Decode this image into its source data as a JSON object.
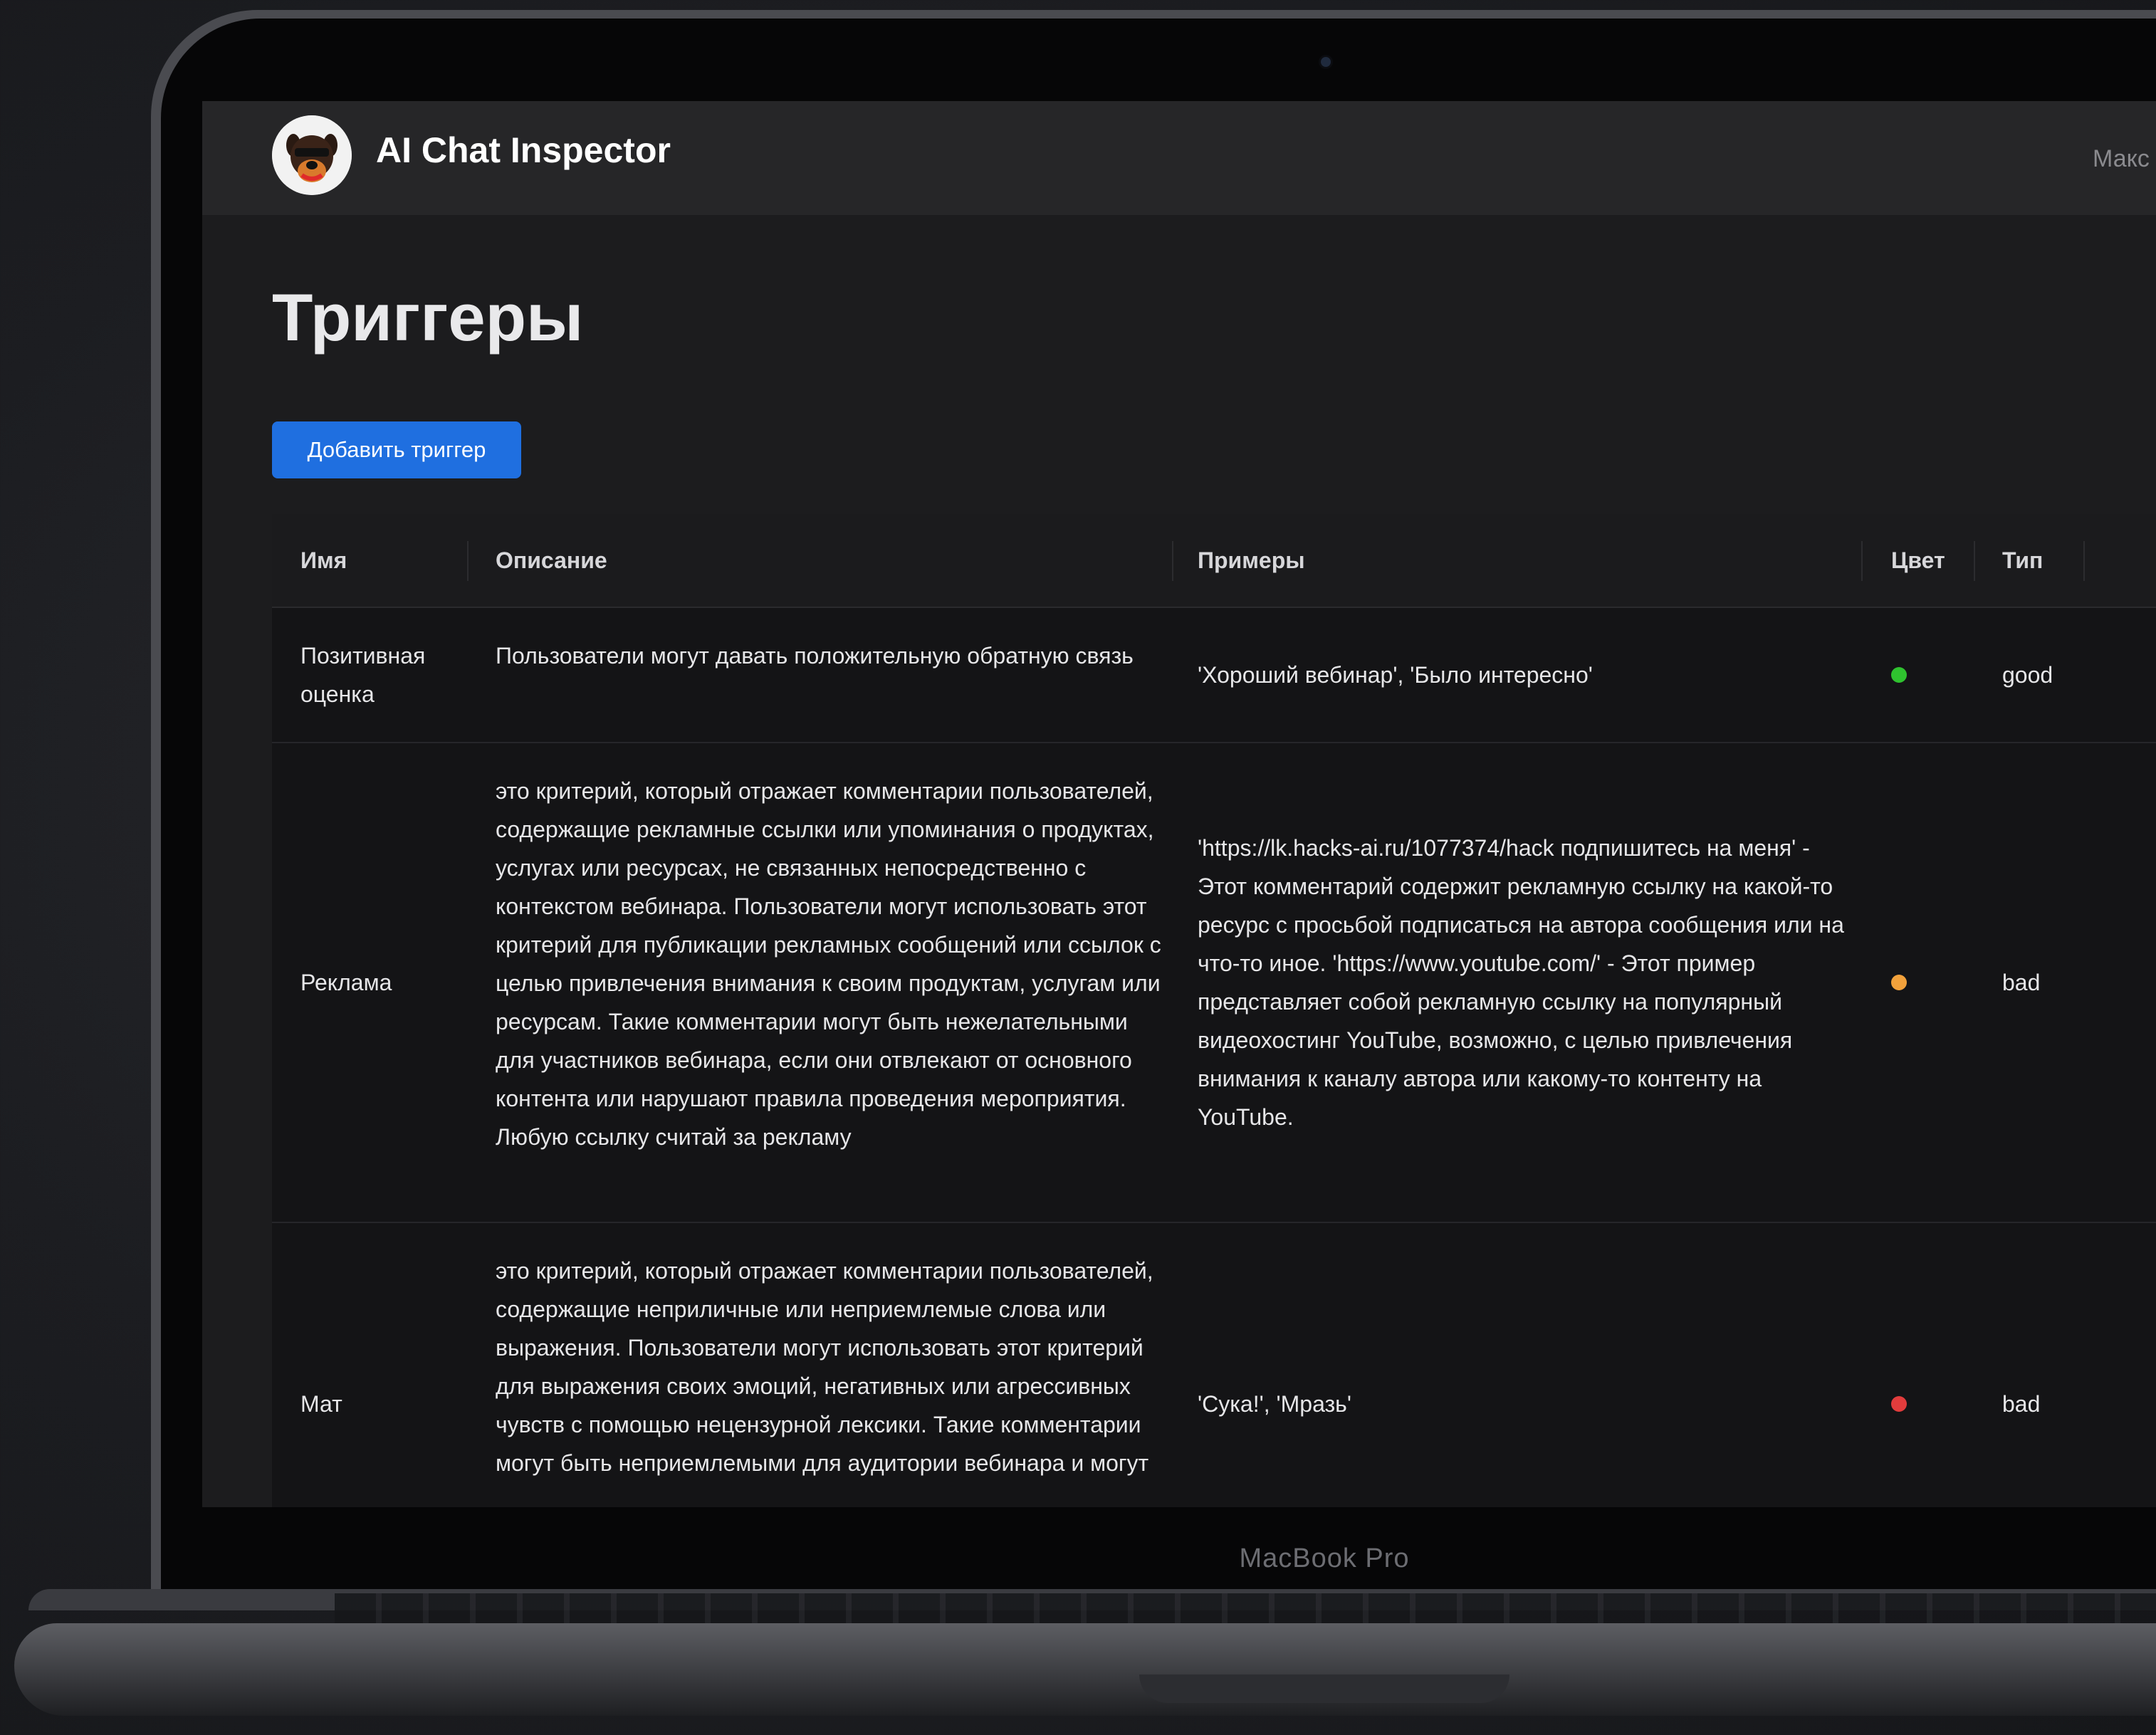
{
  "app": {
    "title": "AI Chat Inspector",
    "user": "Макс"
  },
  "page": {
    "title": "Триггеры",
    "add_button": "Добавить триггер"
  },
  "table": {
    "columns": [
      "Имя",
      "Описание",
      "Примеры",
      "Цвет",
      "Тип"
    ],
    "rows": [
      {
        "name": "Позитивная оценка",
        "description": "Пользователи могут давать положительную обратную связь",
        "examples": "'Хороший вебинар', 'Было интересно'",
        "color": "#2fc22f",
        "type": "good"
      },
      {
        "name": "Реклама",
        "description": "это критерий, который отражает комментарии пользователей, содержащие рекламные ссылки или упоминания о продуктах, услугах или ресурсах, не связанных непосредственно с контекстом вебинара. Пользователи могут использовать этот критерий для публикации рекламных сообщений или ссылок с целью привлечения внимания к своим продуктам, услугам или ресурсам. Такие комментарии могут быть нежелательными для участников вебинара, если они отвлекают от основного контента или нарушают правила проведения мероприятия. Любую ссылку считай за рекламу",
        "examples": "'https://lk.hacks-ai.ru/1077374/hack подпишитесь на меня' - Этот комментарий содержит рекламную ссылку на какой-то ресурс с просьбой подписаться на автора сообщения или на что-то иное. 'https://www.youtube.com/' - Этот пример представляет собой рекламную ссылку на популярный видеохостинг YouTube, возможно, с целью привлечения внимания к каналу автора или какому-то контенту на YouTube.",
        "color": "#f2a13b",
        "type": "bad"
      },
      {
        "name": "Мат",
        "description": "это критерий, который отражает комментарии пользователей, содержащие неприличные или неприемлемые слова или выражения. Пользователи могут использовать этот критерий для выражения своих эмоций, негативных или агрессивных чувств с помощью нецензурной лексики. Такие комментарии могут быть неприемлемыми для аудитории вебинара и могут",
        "examples": "'Сука!', 'Мразь'",
        "color": "#e23c3c",
        "type": "bad"
      }
    ]
  },
  "device": {
    "label": "MacBook Pro"
  }
}
